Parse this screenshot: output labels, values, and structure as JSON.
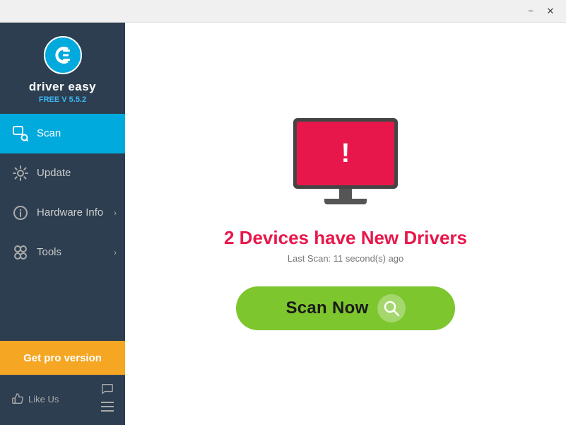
{
  "window": {
    "title": "Driver Easy",
    "min_label": "−",
    "close_label": "✕"
  },
  "sidebar": {
    "logo_alt": "Driver Easy Logo",
    "app_name": "driver easy",
    "version": "FREE V 5.5.2",
    "nav_items": [
      {
        "id": "scan",
        "label": "Scan",
        "active": true,
        "has_chevron": false
      },
      {
        "id": "update",
        "label": "Update",
        "active": false,
        "has_chevron": false
      },
      {
        "id": "hardware-info",
        "label": "Hardware Info",
        "active": false,
        "has_chevron": true
      },
      {
        "id": "tools",
        "label": "Tools",
        "active": false,
        "has_chevron": true
      }
    ],
    "get_pro_label": "Get pro version",
    "like_us_label": "Like Us"
  },
  "content": {
    "devices_count": "2",
    "headline": "2 Devices have New Drivers",
    "last_scan_label": "Last Scan: 11 second(s) ago",
    "scan_now_label": "Scan Now",
    "monitor_exclaim": "!"
  }
}
